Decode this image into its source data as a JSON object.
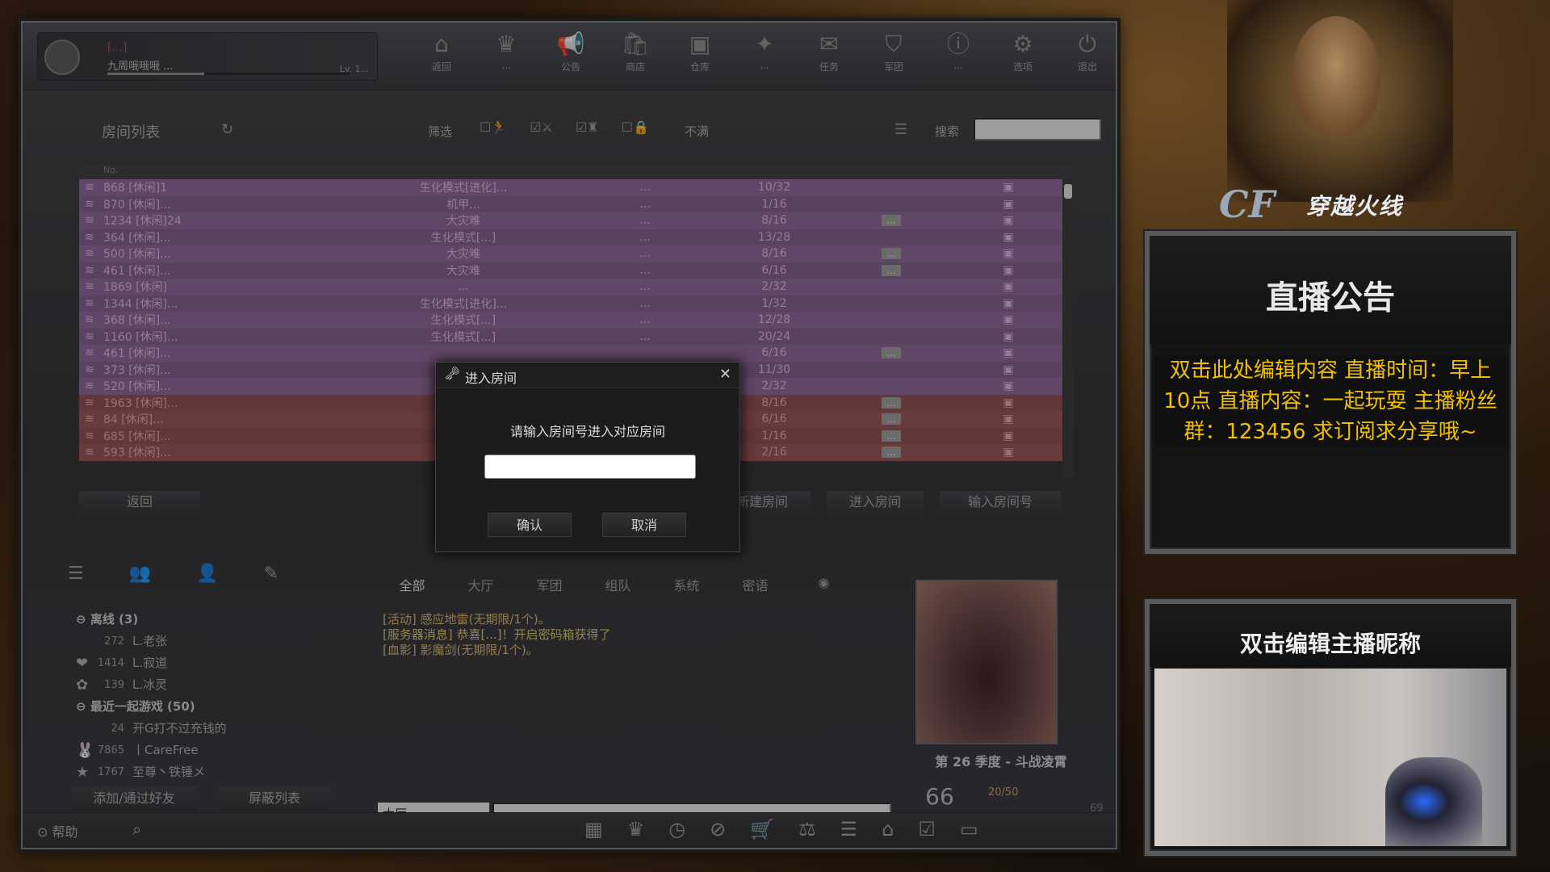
{
  "profile": {
    "name": "[...]",
    "clan": "九周哦哦哦 ...",
    "level": "Lv. 1..."
  },
  "nav": [
    {
      "icon": "home-icon",
      "glyph": "⌂",
      "label": "返回"
    },
    {
      "icon": "crown-icon",
      "glyph": "♛",
      "label": "..."
    },
    {
      "icon": "megaphone-icon",
      "glyph": "📢",
      "label": "公告"
    },
    {
      "icon": "shop-icon",
      "glyph": "🛍",
      "label": "商店"
    },
    {
      "icon": "warehouse-icon",
      "glyph": "▣",
      "label": "仓库"
    },
    {
      "icon": "blueprint-icon",
      "glyph": "✦",
      "label": "..."
    },
    {
      "icon": "task-icon",
      "glyph": "✉",
      "label": "任务"
    },
    {
      "icon": "clan-shield-icon",
      "glyph": "⛉",
      "label": "军团"
    },
    {
      "icon": "alert-icon",
      "glyph": "ⓘ",
      "label": "..."
    },
    {
      "icon": "settings-icon",
      "glyph": "⚙",
      "label": "选项"
    },
    {
      "icon": "power-icon",
      "glyph": "⏻",
      "label": "退出"
    }
  ],
  "room_list": {
    "title": "房间列表",
    "filter_label": "筛选",
    "full_label": "不满",
    "search_label": "搜索",
    "search_value": "",
    "rows": [
      {
        "style": "p",
        "id": "868",
        "name": "[休闲]1",
        "mode": "生化模式[进化]...",
        "map": "...",
        "players": "10/32",
        "status": ""
      },
      {
        "style": "p",
        "id": "870",
        "name": "[休闲]...",
        "mode": "机甲...",
        "map": "...",
        "players": "1/16",
        "status": ""
      },
      {
        "style": "p",
        "id": "1234",
        "name": "[休闲]24",
        "mode": "大灾难",
        "map": "...",
        "players": "8/16",
        "status": "..."
      },
      {
        "style": "p",
        "id": "364",
        "name": "[休闲]...",
        "mode": "生化模式[...]",
        "map": "...",
        "players": "13/28",
        "status": ""
      },
      {
        "style": "p",
        "id": "500",
        "name": "[休闲]...",
        "mode": "大灾难",
        "map": "...",
        "players": "8/16",
        "status": "..."
      },
      {
        "style": "p",
        "id": "461",
        "name": "[休闲]...",
        "mode": "大灾难",
        "map": "...",
        "players": "6/16",
        "status": "..."
      },
      {
        "style": "p",
        "id": "1869",
        "name": "[休闲]",
        "mode": "...",
        "map": "...",
        "players": "2/32",
        "status": ""
      },
      {
        "style": "p",
        "id": "1344",
        "name": "[休闲]...",
        "mode": "生化模式[进化]...",
        "map": "...",
        "players": "1/32",
        "status": ""
      },
      {
        "style": "p",
        "id": "368",
        "name": "[休闲]...",
        "mode": "生化模式[...]",
        "map": "...",
        "players": "12/28",
        "status": ""
      },
      {
        "style": "p",
        "id": "1160",
        "name": "[休闲]...",
        "mode": "生化模式[...]",
        "map": "...",
        "players": "20/24",
        "status": ""
      },
      {
        "style": "p",
        "id": "461",
        "name": "[休闲]...",
        "mode": "",
        "map": "",
        "players": "6/16",
        "status": "..."
      },
      {
        "style": "p",
        "id": "373",
        "name": "[休闲]...",
        "mode": "",
        "map": "",
        "players": "11/30",
        "status": ""
      },
      {
        "style": "p",
        "id": "520",
        "name": "[休闲]...",
        "mode": "",
        "map": "",
        "players": "2/32",
        "status": ""
      },
      {
        "style": "r",
        "id": "1963",
        "name": "[休闲]...",
        "mode": "",
        "map": "",
        "players": "8/16",
        "status": "..."
      },
      {
        "style": "r",
        "id": "84",
        "name": "[休闲]...",
        "mode": "",
        "map": "",
        "players": "6/16",
        "status": "..."
      },
      {
        "style": "r",
        "id": "685",
        "name": "[休闲]...",
        "mode": "",
        "map": "",
        "players": "1/16",
        "status": "..."
      },
      {
        "style": "r",
        "id": "593",
        "name": "[休闲]...",
        "mode": "",
        "map": "",
        "players": "2/16",
        "status": "..."
      }
    ],
    "buttons": {
      "back": "返回",
      "create": "新建房间",
      "enter": "进入房间",
      "enter_number": "输入房间号"
    }
  },
  "modal": {
    "title": "进入房间",
    "prompt": "请输入房间号进入对应房间",
    "input_value": "",
    "confirm": "确认",
    "cancel": "取消"
  },
  "friends": {
    "groups": [
      {
        "label": "离线 (3)",
        "items": [
          {
            "num": "272",
            "name": "L.老张",
            "icon": ""
          },
          {
            "num": "1414",
            "name": "L.寂道",
            "icon": "❤"
          },
          {
            "num": "139",
            "name": "L.冰灵",
            "icon": "✿"
          }
        ]
      },
      {
        "label": "最近一起游戏 (50)",
        "items": [
          {
            "num": "24",
            "name": "开G打不过充钱的",
            "icon": ""
          },
          {
            "num": "7865",
            "name": "丨CareFree",
            "icon": "🐰"
          },
          {
            "num": "1767",
            "name": "至尊丶铁锤メ",
            "icon": "★"
          }
        ]
      }
    ],
    "add_button": "添加/通过好友",
    "block_button": "屏蔽列表"
  },
  "chat": {
    "tabs": [
      "全部",
      "大厅",
      "军团",
      "组队",
      "系统",
      "密语"
    ],
    "messages": [
      {
        "cls": "m1",
        "text": "[活动] 感应地雷(无期限/1个)。"
      },
      {
        "cls": "m2",
        "text": "[服务器消息] 恭喜[...]！开启密码箱获得了"
      },
      {
        "cls": "m1",
        "text": "[血影] 影魔剑(无期限/1个)。"
      }
    ],
    "channel": "大厅",
    "input_value": ""
  },
  "season": {
    "title": "第 26 季度 - 斗战凌霄",
    "level": "66",
    "progress": "20/50",
    "max": "69"
  },
  "bottombar": {
    "help": "帮助",
    "icons": [
      "calendar-icon",
      "crown-w-icon",
      "clock-icon",
      "compass-icon",
      "cart-icon",
      "scale-icon",
      "list-icon",
      "house-icon",
      "checklist-icon",
      "card-icon"
    ],
    "glyphs": [
      "▦",
      "♛",
      "◷",
      "⊘",
      "🛒",
      "⚖",
      "☰",
      "⌂",
      "☑",
      "▭"
    ]
  },
  "stream": {
    "logo_prefix": "CF",
    "logo_text": "穿越火线",
    "notice_title": "直播公告",
    "notice_body": "双击此处编辑内容 直播时间：早上10点 直播内容：一起玩耍 主播粉丝群：123456 求订阅求分享哦~",
    "cam_title": "双击编辑主播昵称"
  }
}
